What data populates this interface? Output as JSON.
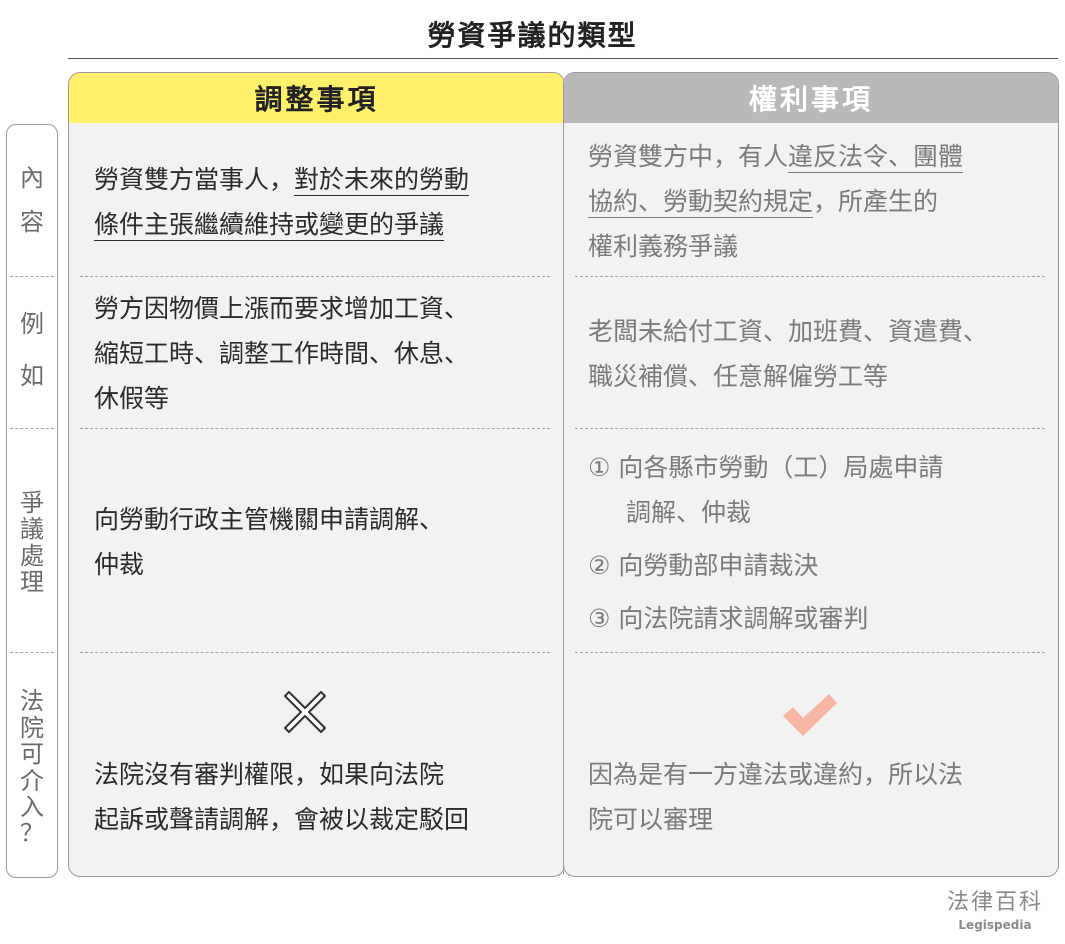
{
  "title": "勞資爭議的類型",
  "columns": {
    "left_header": "調整事項",
    "right_header": "權利事項"
  },
  "rows": [
    {
      "label_chars": [
        "內",
        "容"
      ]
    },
    {
      "label_chars": [
        "例",
        "如"
      ]
    },
    {
      "label_chars": [
        "爭",
        "議",
        "處",
        "理"
      ]
    },
    {
      "label_chars": [
        "法",
        "院",
        "可",
        "介",
        "入",
        "？"
      ]
    }
  ],
  "content": {
    "left_line1_a": "勞資雙方當事人，",
    "left_line1_b": "對於未來的勞動",
    "left_line2": "條件主張繼續維持或變更的爭議",
    "right_line1_a": "勞資雙方中，有人",
    "right_line1_b": "違反法令、團體",
    "right_line2_a": "協約、勞動契約規定",
    "right_line2_b": "，所產生的",
    "right_line3": "權利義務爭議"
  },
  "examples": {
    "left_lines": [
      "勞方因物價上漲而要求增加工資、",
      "縮短工時、調整工作時間、休息、",
      "休假等"
    ],
    "right_lines": [
      "老闆未給付工資、加班費、資遣費、",
      "職災補償、任意解僱勞工等"
    ]
  },
  "dispute": {
    "left_lines": [
      "向勞動行政主管機關申請調解、",
      "仲裁"
    ],
    "right_items": [
      {
        "num": "①",
        "line1": "向各縣市勞動（工）局處申請",
        "line2": "調解、仲裁"
      },
      {
        "num": "②",
        "line1": "向勞動部申請裁決"
      },
      {
        "num": "③",
        "line1": "向法院請求調解或審判"
      }
    ]
  },
  "court": {
    "left_icon": "cross-icon",
    "right_icon": "check-icon",
    "left_lines": [
      "法院沒有審判權限，如果向法院",
      "起訴或聲請調解，會被以裁定駁回"
    ],
    "right_lines": [
      "因為是有一方違法或違約，所以法",
      "院可以審理"
    ]
  },
  "brand": {
    "zh": "法律百科",
    "en": "Legispedia"
  },
  "colors": {
    "left_header_bg": "#fff06b",
    "right_header_bg": "#b9b9b9",
    "check": "#f7b5a6"
  }
}
